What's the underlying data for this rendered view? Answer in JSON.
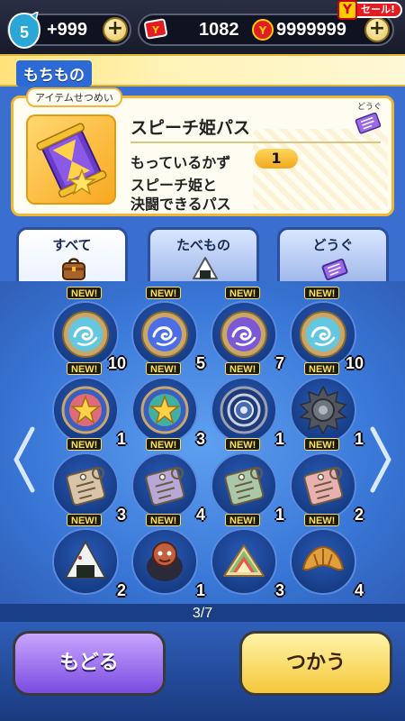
{
  "topbar": {
    "level": "5",
    "left_value": "+999",
    "currency1_value": "1082",
    "currency2_value": "9999999",
    "sale_label": "セール!"
  },
  "header": {
    "title": "もちもの"
  },
  "item_detail": {
    "panel_label": "アイテムせつめい",
    "category": "どうぐ",
    "name": "スピーチ姫パス",
    "qty_label": "もっているかず",
    "qty_value": "1",
    "description_line1": "スピーチ姫と",
    "description_line2": "決闘できるパス"
  },
  "tabs": [
    {
      "label": "すべて",
      "icon": "bag-icon",
      "active": true
    },
    {
      "label": "たべもの",
      "icon": "onigiri-icon",
      "active": false
    },
    {
      "label": "どうぐ",
      "icon": "ticket-icon",
      "active": false
    }
  ],
  "grid": {
    "new_label": "NEW!",
    "items": [
      {
        "icon": "wind-orb-icon",
        "qty": "10",
        "color": "#63c7e0"
      },
      {
        "icon": "wind-orb-icon",
        "qty": "5",
        "color": "#4b6ee6"
      },
      {
        "icon": "wind-orb-icon",
        "qty": "7",
        "color": "#7b58d6"
      },
      {
        "icon": "wind-orb-icon",
        "qty": "10",
        "color": "#63c7e0"
      },
      {
        "icon": "star-medal-icon",
        "qty": "1",
        "color": "#e06a7a"
      },
      {
        "icon": "star-medal-icon",
        "qty": "3",
        "color": "#40b0a0"
      },
      {
        "icon": "ring-orb-icon",
        "qty": "1",
        "color": "#9aa0b0"
      },
      {
        "icon": "spiked-orb-icon",
        "qty": "1",
        "color": "#505560"
      },
      {
        "icon": "ticket-tag-icon",
        "qty": "3",
        "color": "#d8c4a8"
      },
      {
        "icon": "ticket-tag-icon",
        "qty": "4",
        "color": "#b8a8d8"
      },
      {
        "icon": "ticket-tag-icon",
        "qty": "1",
        "color": "#a8c8a8"
      },
      {
        "icon": "ticket-tag-icon",
        "qty": "2",
        "color": "#e8b0b0"
      },
      {
        "icon": "onigiri-icon",
        "qty": "2",
        "color": "#f2f2f2"
      },
      {
        "icon": "character-icon",
        "qty": "1",
        "color": "#c06040"
      },
      {
        "icon": "sandwich-icon",
        "qty": "3",
        "color": "#80c070"
      },
      {
        "icon": "croissant-icon",
        "qty": "4",
        "color": "#e0a040"
      }
    ]
  },
  "pagination": {
    "text": "3/7"
  },
  "buttons": {
    "back_label": "もどる",
    "use_label": "つかう"
  }
}
